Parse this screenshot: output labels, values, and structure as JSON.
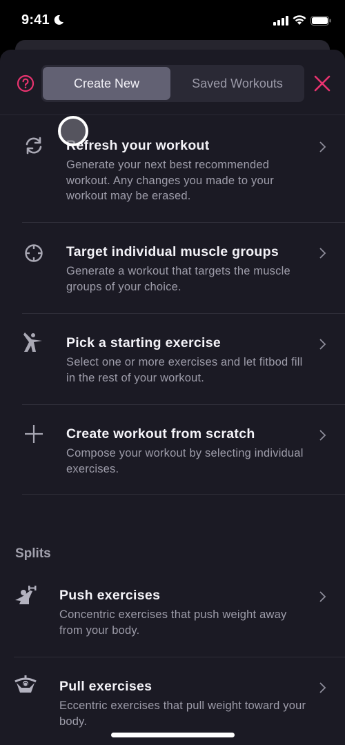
{
  "status_bar": {
    "time": "9:41",
    "icons": [
      "moon-icon",
      "signal-icon",
      "wifi-icon",
      "battery-icon"
    ]
  },
  "header": {
    "help_icon": "question-circle-icon",
    "tabs": [
      {
        "label": "Create New",
        "active": true
      },
      {
        "label": "Saved Workouts",
        "active": false
      }
    ],
    "close_icon": "close-x-icon"
  },
  "colors": {
    "accent": "#e8336f",
    "background": "#1b1a24",
    "segment_active": "#626173",
    "segment_bg": "#2a2935",
    "title_text": "#f4f3f8",
    "desc_text": "#9e9daa"
  },
  "options": [
    {
      "icon": "refresh-icon",
      "title": "Refresh your workout",
      "description": "Generate your next best recommended workout. Any changes you made to your workout may be erased."
    },
    {
      "icon": "crosshair-target-icon",
      "title": "Target individual muscle groups",
      "description": "Generate a workout that targets the muscle groups of your choice."
    },
    {
      "icon": "person-exercise-icon",
      "title": "Pick a starting exercise",
      "description": "Select one or more exercises and let fitbod fill in the rest of your workout."
    },
    {
      "icon": "plus-icon",
      "title": "Create workout from scratch",
      "description": "Compose your workout by selecting individual exercises."
    }
  ],
  "splits": {
    "label": "Splits",
    "items": [
      {
        "icon": "push-dumbbell-icon",
        "title": "Push exercises",
        "description": "Concentric exercises that push weight away from your body."
      },
      {
        "icon": "pull-bar-icon",
        "title": "Pull exercises",
        "description": "Eccentric exercises that pull weight toward your body."
      }
    ]
  }
}
